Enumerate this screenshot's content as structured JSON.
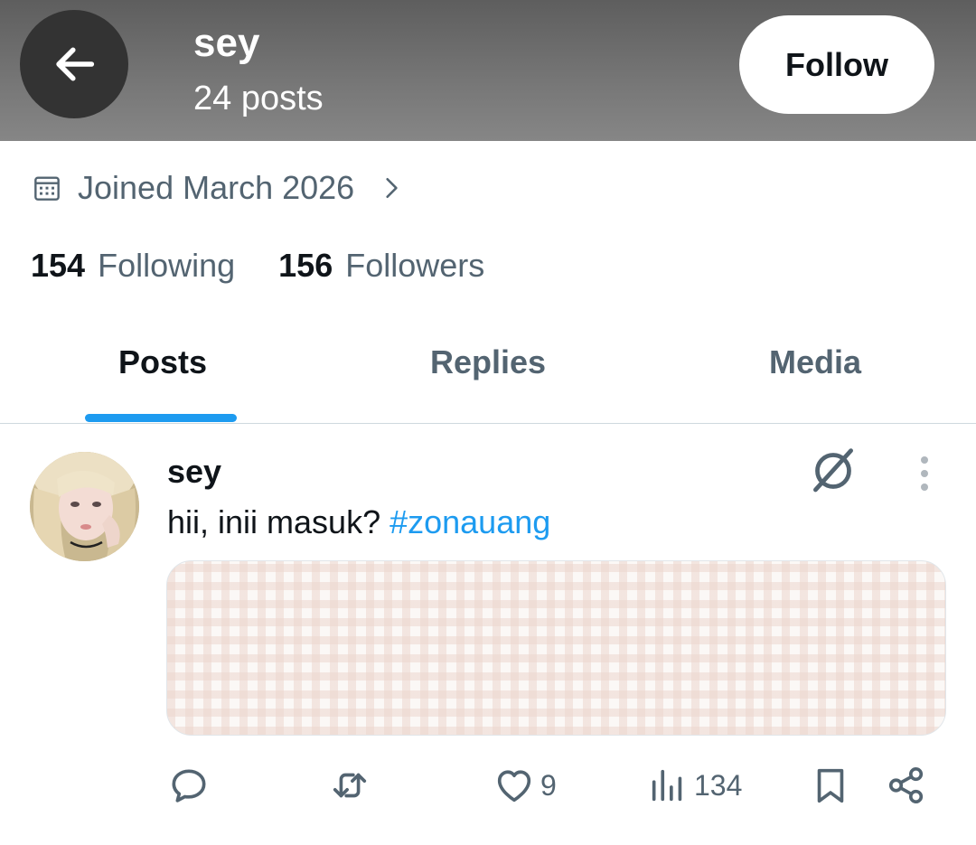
{
  "header": {
    "name": "sey",
    "post_count": "24 posts",
    "follow_label": "Follow"
  },
  "profile": {
    "joined": "Joined March 2026",
    "following_count": "154",
    "following_label": "Following",
    "followers_count": "156",
    "followers_label": "Followers"
  },
  "tabs": [
    {
      "label": "Posts",
      "active": true
    },
    {
      "label": "Replies",
      "active": false
    },
    {
      "label": "Media",
      "active": false
    }
  ],
  "post": {
    "author": "sey",
    "text": "hii, inii masuk? ",
    "hashtag": "#zonauang",
    "likes": "9",
    "views": "134"
  },
  "icons": {
    "back": "arrow-left-icon",
    "calendar": "calendar-icon",
    "chevron": "chevron-right-icon",
    "grok": "grok-icon",
    "more": "more-vertical-icon",
    "reply": "reply-icon",
    "repost": "repost-icon",
    "like": "heart-icon",
    "views": "views-icon",
    "bookmark": "bookmark-icon",
    "share": "share-icon"
  },
  "colors": {
    "accent": "#1d9bf0",
    "text_primary": "#0f1419",
    "text_secondary": "#536471",
    "header_dark": "#333333"
  }
}
